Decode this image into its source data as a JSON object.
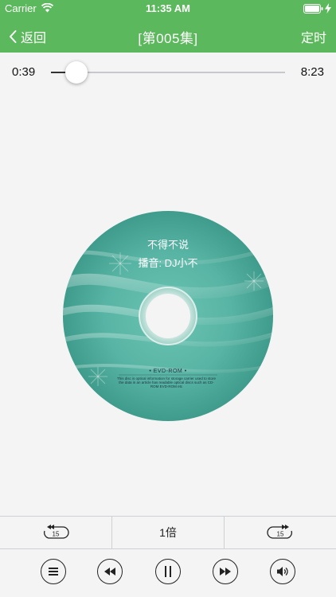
{
  "status_bar": {
    "carrier": "Carrier",
    "time": "11:35 AM"
  },
  "nav": {
    "back_label": "返回",
    "title": "[第005集]",
    "timer_label": "定时"
  },
  "progress": {
    "current_time": "0:39",
    "total_time": "8:23",
    "fraction": 0.11
  },
  "disc": {
    "title": "不得不说",
    "artist": "播音: DJ小不",
    "format": "• EVD-ROM •",
    "fine_print": "This disc is optical information for storage carrier used to store the data in an article has readable optical discs such as CD-ROM EVD-ROM etc",
    "color": "#58b4a4"
  },
  "controls": {
    "rewind_15_label": "15",
    "speed_label": "1倍",
    "forward_15_label": "15"
  },
  "colors": {
    "header": "#5cb85c",
    "background": "#f4f4f4"
  }
}
